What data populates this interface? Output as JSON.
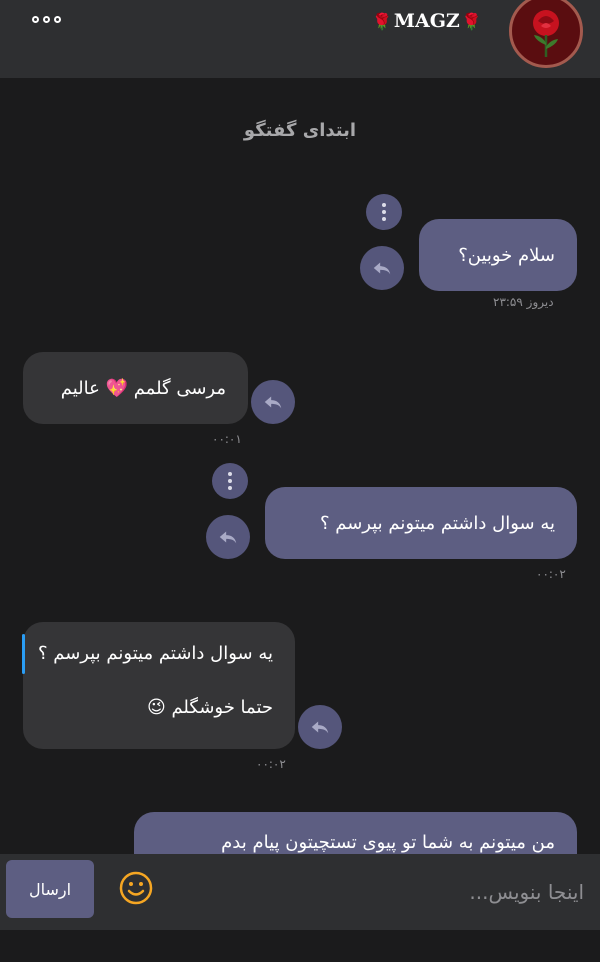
{
  "header": {
    "title": "MAGZ",
    "title_decoration": "🌹",
    "menu_icon": "more-horizontal-icon",
    "avatar_icon": "rose-icon"
  },
  "chat": {
    "start_label": "ابتدای گفتگو",
    "messages": [
      {
        "text": "سلام خوبین؟",
        "time": "دیروز ۲۳:۵۹",
        "sender": "me"
      },
      {
        "text": "مرسی گلمم 💖 عالیم",
        "time": "۰۰:۰۱",
        "sender": "them"
      },
      {
        "text": "یه سوال داشتم میتونم بپرسم ؟",
        "time": "۰۰:۰۲",
        "sender": "me"
      },
      {
        "quote": "یه سوال داشتم میتونم بپرسم ؟",
        "text": "حتما خوشگلم 😉",
        "time": "۰۰:۰۲",
        "sender": "them"
      },
      {
        "text": "من میتونم به شما تو پیوی تستچیتون پیام بدم",
        "sender": "me"
      }
    ]
  },
  "composer": {
    "send_label": "ارسال",
    "placeholder": "اینجا بنویس...",
    "emoji_icon": "smiley-icon"
  },
  "colors": {
    "header_bg": "#2e2f31",
    "chat_bg": "#1b1b1c",
    "my_bubble": "#5d5e82",
    "their_bubble": "#353537",
    "quote_bar": "#2a9df4",
    "emoji_accent": "#f5a623"
  }
}
